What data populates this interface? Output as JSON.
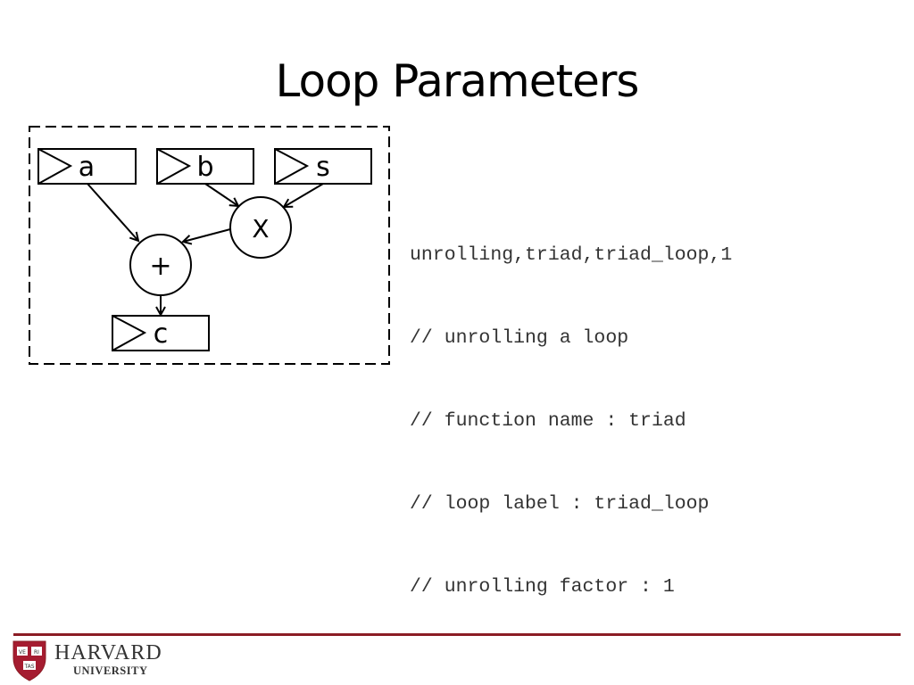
{
  "slide": {
    "title": "Loop Parameters"
  },
  "diagram": {
    "registers": [
      {
        "id": "a",
        "label": "a"
      },
      {
        "id": "b",
        "label": "b"
      },
      {
        "id": "s",
        "label": "s"
      },
      {
        "id": "c",
        "label": "c"
      }
    ],
    "operators": [
      {
        "id": "mul",
        "label": "X"
      },
      {
        "id": "add",
        "label": "+"
      }
    ],
    "edges": [
      {
        "from": "b",
        "to": "mul"
      },
      {
        "from": "s",
        "to": "mul"
      },
      {
        "from": "a",
        "to": "add"
      },
      {
        "from": "mul",
        "to": "add"
      },
      {
        "from": "add",
        "to": "c"
      }
    ]
  },
  "code": {
    "lines": [
      "unrolling,triad,triad_loop,1",
      "// unrolling a loop",
      "// function name : triad",
      "// loop label : triad_loop",
      "// unrolling factor : 1"
    ]
  },
  "footer": {
    "institution": "HARVARD",
    "subtitle": "UNIVERSITY",
    "shield_text": [
      "VE",
      "RI",
      "TAS"
    ],
    "accent_color": "#8b1c24"
  }
}
